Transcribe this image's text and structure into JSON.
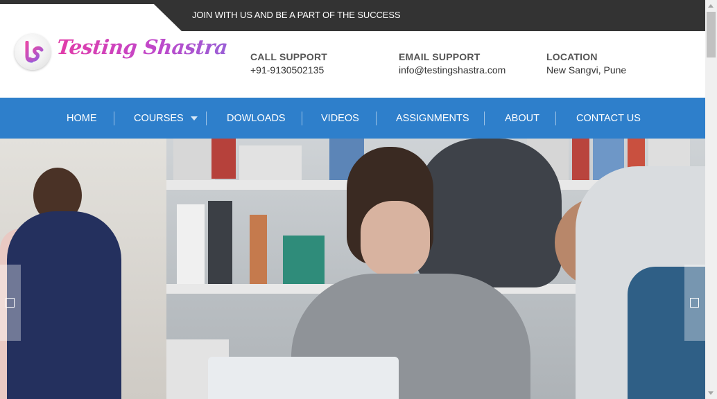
{
  "topbar": {
    "tagline": "JOIN WITH US AND BE A PART OF THE SUCCESS"
  },
  "brand": {
    "name": "Testing Shastra",
    "badge_letters": "ts"
  },
  "contacts": [
    {
      "label": "CALL SUPPORT",
      "value": "+91-9130502135"
    },
    {
      "label": "EMAIL SUPPORT",
      "value": "info@testingshastra.com"
    },
    {
      "label": "LOCATION",
      "value": "New Sangvi, Pune"
    }
  ],
  "nav": {
    "items": [
      {
        "label": "HOME"
      },
      {
        "label": "COURSES",
        "has_dropdown": true
      },
      {
        "label": "DOWLOADS"
      },
      {
        "label": "VIDEOS"
      },
      {
        "label": "ASSIGNMENTS"
      },
      {
        "label": "ABOUT"
      },
      {
        "label": "CONTACT US"
      }
    ]
  },
  "colors": {
    "topbar": "#333333",
    "nav": "#2e7fcb",
    "brand_pink": "#e23ca8",
    "brand_purple": "#9a5fd6"
  },
  "hero": {
    "icons": {
      "prev": "prev-slide-icon",
      "next": "next-slide-icon"
    }
  }
}
